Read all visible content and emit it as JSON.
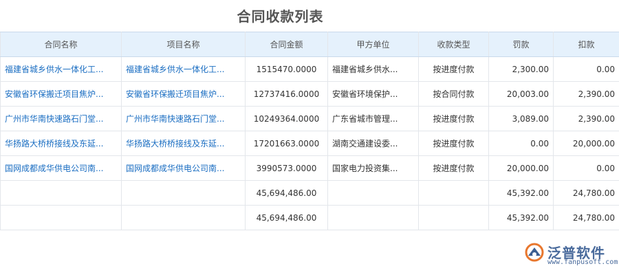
{
  "page_title": "合同收款列表",
  "columns": [
    "合同名称",
    "项目名称",
    "合同金额",
    "甲方单位",
    "收款类型",
    "罚款",
    "扣款"
  ],
  "rows": [
    {
      "contract_name": "福建省城乡供水一体化工...",
      "project_name": "福建省城乡供水一体化工...",
      "amount": "1515470.0000",
      "party_a": "福建省城乡供水...",
      "type": "按进度付款",
      "penalty": "2,300.00",
      "deduction": "0.00"
    },
    {
      "contract_name": "安徽省环保搬迁项目焦炉...",
      "project_name": "安徽省环保搬迁项目焦炉...",
      "amount": "12737416.0000",
      "party_a": "安徽省环境保护...",
      "type": "按合同付款",
      "penalty": "20,003.00",
      "deduction": "2,390.00"
    },
    {
      "contract_name": "广州市华南快速路石门堂...",
      "project_name": "广州市华南快速路石门堂...",
      "amount": "10249364.0000",
      "party_a": "广东省城市管理...",
      "type": "按进度付款",
      "penalty": "3,089.00",
      "deduction": "2,390.00"
    },
    {
      "contract_name": "华扬路大桥桥接线及东延...",
      "project_name": "华扬路大桥桥接线及东延...",
      "amount": "17201663.0000",
      "party_a": "湖南交通建设委...",
      "type": "按进度付款",
      "penalty": "0.00",
      "deduction": "20,000.00"
    },
    {
      "contract_name": "国网成都成华供电公司南...",
      "project_name": "国网成都成华供电公司南...",
      "amount": "3990573.0000",
      "party_a": "国家电力投资集...",
      "type": "按进度付款",
      "penalty": "20,000.00",
      "deduction": "0.00"
    }
  ],
  "subtotal": {
    "amount": "45,694,486.00",
    "penalty": "45,392.00",
    "deduction": "24,780.00"
  },
  "total": {
    "amount": "45,694,486.00",
    "penalty": "45,392.00",
    "deduction": "24,780.00"
  },
  "logo": {
    "text": "泛普软件",
    "url": "www.fanpusoft.com"
  },
  "colors": {
    "header_bg": "#e5f1fc",
    "link": "#1b6ec2",
    "border": "#e3e6eb",
    "title": "#555555"
  }
}
